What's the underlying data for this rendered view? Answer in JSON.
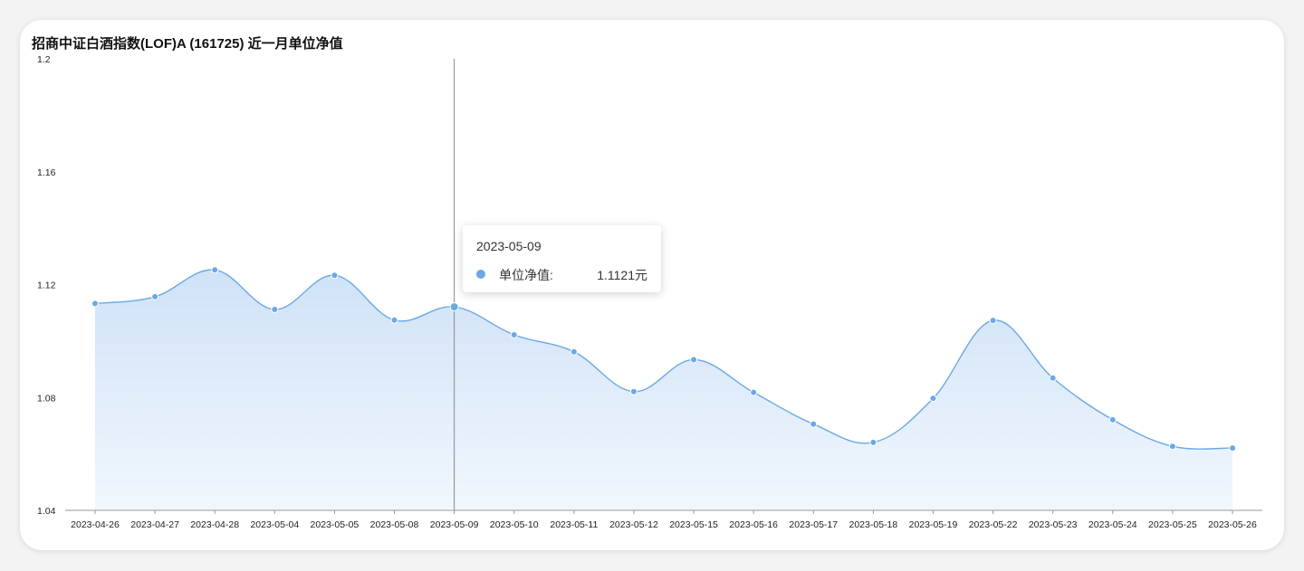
{
  "colors": {
    "line": "#6aa8e6",
    "area_top": "#cfe2f7",
    "area_bottom": "#f1f7fd",
    "axis": "#999999",
    "cursor": "#888888"
  },
  "tooltip": {
    "date": "2023-05-09",
    "label": "单位净值:",
    "value": "1.1121元"
  },
  "chart_data": {
    "type": "area",
    "title": "招商中证白酒指数(LOF)A (161725) 近一月单位净值",
    "xlabel": "",
    "ylabel": "",
    "ylim": [
      1.04,
      1.2
    ],
    "yticks": [
      "1.04",
      "1.08",
      "1.12",
      "1.16",
      "1.2"
    ],
    "grid": false,
    "categories": [
      "2023-04-26",
      "2023-04-27",
      "2023-04-28",
      "2023-05-04",
      "2023-05-05",
      "2023-05-08",
      "2023-05-09",
      "2023-05-10",
      "2023-05-11",
      "2023-05-12",
      "2023-05-15",
      "2023-05-16",
      "2023-05-17",
      "2023-05-18",
      "2023-05-19",
      "2023-05-22",
      "2023-05-23",
      "2023-05-24",
      "2023-05-25",
      "2023-05-26"
    ],
    "series": [
      {
        "values": [
          1.1133,
          1.1157,
          1.1252,
          1.1112,
          1.1233,
          1.1074,
          1.1121,
          1.1022,
          1.0962,
          1.0821,
          1.0934,
          1.0818,
          1.0706,
          1.0641,
          1.0797,
          1.1073,
          1.0869,
          1.0721,
          1.0627,
          1.0621
        ]
      }
    ],
    "highlight_index": 6
  }
}
